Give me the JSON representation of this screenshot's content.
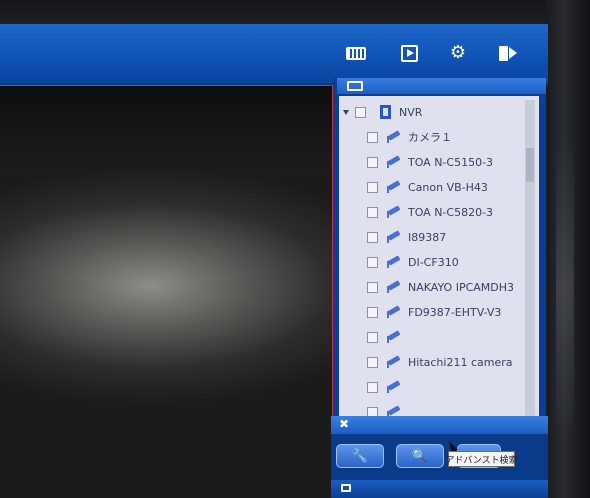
{
  "toolbar": {
    "icons": [
      "keyboard-icon",
      "play-icon",
      "settings-icon",
      "exit-icon"
    ]
  },
  "device_tree": {
    "root": {
      "label": "NVR",
      "expanded": true
    },
    "cameras": [
      {
        "label": "カメラ１"
      },
      {
        "label": "TOA N-C5150-3"
      },
      {
        "label": "Canon VB-H43"
      },
      {
        "label": "TOA N-C5820-3"
      },
      {
        "label": "I89387"
      },
      {
        "label": "DI-CF310"
      },
      {
        "label": "NAKAYO IPCAMDH3"
      },
      {
        "label": "FD9387-EHTV-V3"
      },
      {
        "label": ""
      },
      {
        "label": "Hitachi211 camera"
      },
      {
        "label": ""
      },
      {
        "label": ""
      }
    ]
  },
  "tools": {
    "buttons": [
      "wrench-icon",
      "search-device-icon",
      "advanced-search-icon"
    ],
    "tooltip": "アドバンスト検索"
  },
  "colors": {
    "toolbar_blue": "#0f52b4",
    "panel_bg": "#dfe1ee",
    "view_border": "#c7363e"
  }
}
